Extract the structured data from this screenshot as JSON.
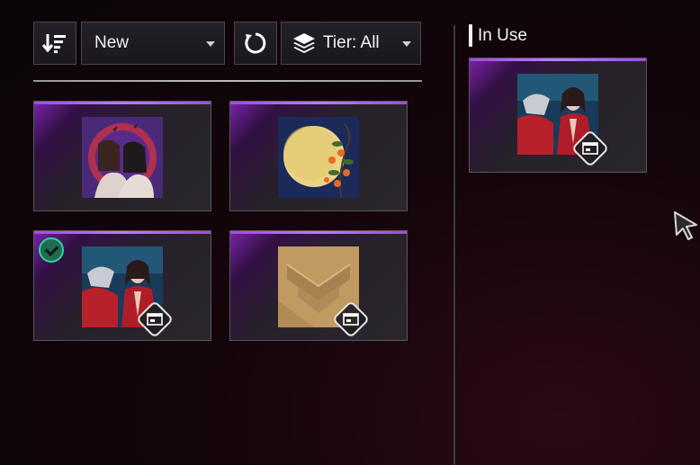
{
  "toolbar": {
    "sort_icon": "sort-descending-icon",
    "sort_dropdown_value": "New",
    "refresh_icon": "refresh-icon",
    "tier_icon": "layers-icon",
    "tier_dropdown_value": "Tier: All"
  },
  "inventory": {
    "items": [
      {
        "art": "halloween-duo-portrait",
        "rarity_color": "#a04be0",
        "equipped": false,
        "has_tag": false
      },
      {
        "art": "moon-persimmon-branch",
        "rarity_color": "#a04be0",
        "equipped": false,
        "has_tag": false
      },
      {
        "art": "red-armor-woman-portrait",
        "rarity_color": "#a04be0",
        "equipped": true,
        "has_tag": true
      },
      {
        "art": "gold-chevron-emblem",
        "rarity_color": "#a04be0",
        "equipped": false,
        "has_tag": true
      }
    ]
  },
  "in_use": {
    "title": "In Use",
    "item": {
      "art": "red-armor-woman-portrait",
      "rarity_color": "#a04be0",
      "has_tag": true
    }
  },
  "icons": {
    "check": "checkmark-icon",
    "tag": "banner-card-icon",
    "cursor": "mouse-cursor-icon"
  }
}
